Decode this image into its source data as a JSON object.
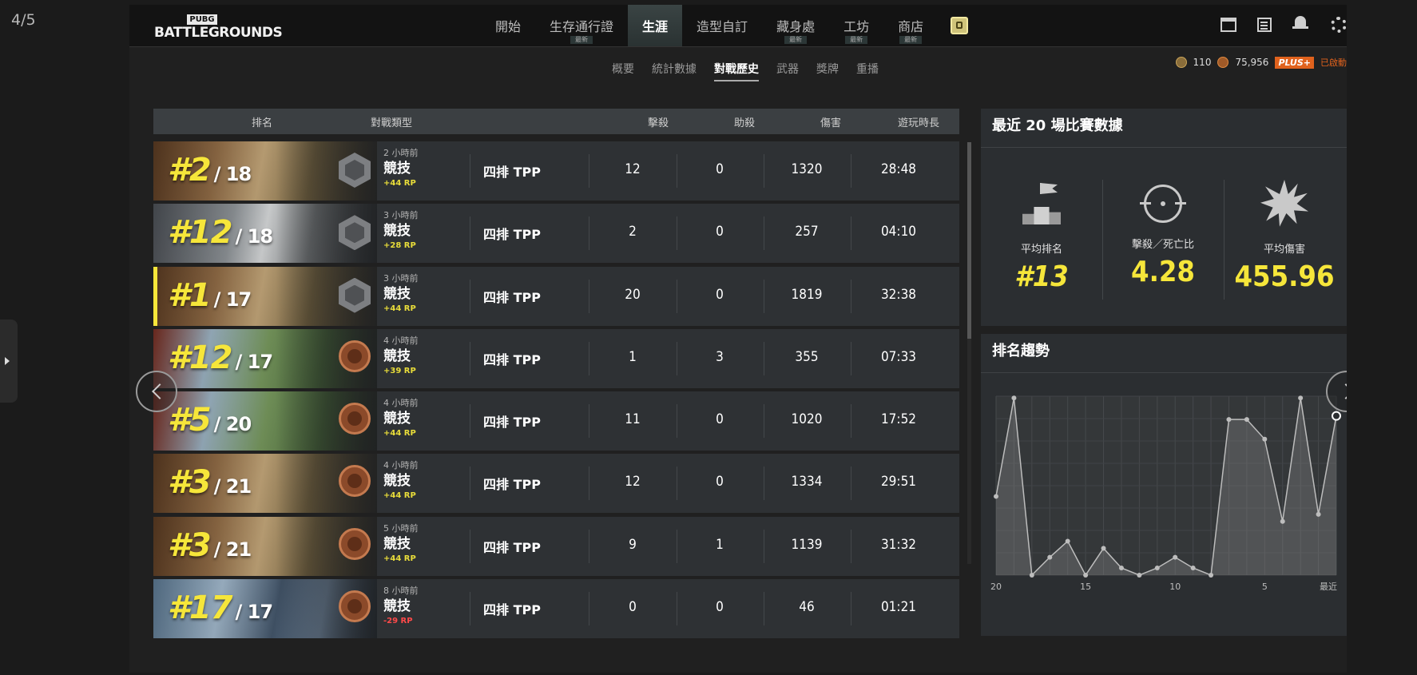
{
  "page_counter": "4/5",
  "header": {
    "logo_top": "PUBG",
    "logo_bottom": "BATTLEGROUNDS",
    "nav": [
      {
        "label": "開始",
        "badge": ""
      },
      {
        "label": "生存通行證",
        "badge": "最新"
      },
      {
        "label": "生涯",
        "badge": "",
        "active": true
      },
      {
        "label": "造型自訂",
        "badge": ""
      },
      {
        "label": "藏身處",
        "badge": "最新"
      },
      {
        "label": "工坊",
        "badge": "最新"
      },
      {
        "label": "商店",
        "badge": "最新"
      }
    ]
  },
  "subtabs": [
    "概要",
    "統計數據",
    "對戰歷史",
    "武器",
    "獎牌",
    "重播"
  ],
  "active_subtab": "對戰歷史",
  "currency": {
    "g_coin": "110",
    "bp": "75,956",
    "plus": "PLUS+",
    "owned": "已啟動"
  },
  "table": {
    "headers": {
      "rank": "排名",
      "type": "對戰類型",
      "kills": "擊殺",
      "assists": "助殺",
      "damage": "傷害",
      "time": "遊玩時長"
    },
    "rows": [
      {
        "rank": "#2",
        "total": "/ 18",
        "ago": "2 小時前",
        "mode": "競技",
        "rp": "+44 RP",
        "squad": "四排 TPP",
        "kills": "12",
        "assists": "0",
        "damage": "1320",
        "time": "28:48",
        "map": "warm",
        "tier": "silver",
        "highlight": false
      },
      {
        "rank": "#12",
        "total": "/ 18",
        "ago": "3 小時前",
        "mode": "競技",
        "rp": "+28 RP",
        "squad": "四排 TPP",
        "kills": "2",
        "assists": "0",
        "damage": "257",
        "time": "04:10",
        "map": "gray",
        "tier": "silver",
        "highlight": false
      },
      {
        "rank": "#1",
        "total": "/ 17",
        "ago": "3 小時前",
        "mode": "競技",
        "rp": "+44 RP",
        "squad": "四排 TPP",
        "kills": "20",
        "assists": "0",
        "damage": "1819",
        "time": "32:38",
        "map": "warm",
        "tier": "silver",
        "highlight": true
      },
      {
        "rank": "#12",
        "total": "/ 17",
        "ago": "4 小時前",
        "mode": "競技",
        "rp": "+39 RP",
        "squad": "四排 TPP",
        "kills": "1",
        "assists": "3",
        "damage": "355",
        "time": "07:33",
        "map": "green",
        "tier": "bronze",
        "highlight": false
      },
      {
        "rank": "#5",
        "total": "/ 20",
        "ago": "4 小時前",
        "mode": "競技",
        "rp": "+44 RP",
        "squad": "四排 TPP",
        "kills": "11",
        "assists": "0",
        "damage": "1020",
        "time": "17:52",
        "map": "green",
        "tier": "bronze",
        "highlight": false
      },
      {
        "rank": "#3",
        "total": "/ 21",
        "ago": "4 小時前",
        "mode": "競技",
        "rp": "+44 RP",
        "squad": "四排 TPP",
        "kills": "12",
        "assists": "0",
        "damage": "1334",
        "time": "29:51",
        "map": "warm",
        "tier": "bronze",
        "highlight": false
      },
      {
        "rank": "#3",
        "total": "/ 21",
        "ago": "5 小時前",
        "mode": "競技",
        "rp": "+44 RP",
        "squad": "四排 TPP",
        "kills": "9",
        "assists": "1",
        "damage": "1139",
        "time": "31:32",
        "map": "warm",
        "tier": "bronze",
        "highlight": false
      },
      {
        "rank": "#17",
        "total": "/ 17",
        "ago": "8 小時前",
        "mode": "競技",
        "rp": "-29 RP",
        "squad": "四排 TPP",
        "kills": "0",
        "assists": "0",
        "damage": "46",
        "time": "01:21",
        "map": "snow",
        "tier": "bronze",
        "highlight": false
      }
    ]
  },
  "stats_panel": {
    "title": "最近 20 場比賽數據",
    "items": [
      {
        "icon": "podium-icon",
        "label": "平均排名",
        "value": "#13"
      },
      {
        "icon": "crosshair-icon",
        "label": "擊殺／死亡比",
        "value": "4.28"
      },
      {
        "icon": "damage-burst-icon",
        "label": "平均傷害",
        "value": "455.96"
      }
    ]
  },
  "trend_panel": {
    "title": "排名趨勢"
  },
  "chart_data": {
    "type": "area",
    "x_tick_labels": [
      "20",
      "15",
      "10",
      "5",
      "最近"
    ],
    "x": [
      20,
      19,
      18,
      17,
      16,
      15,
      14,
      13,
      12,
      11,
      10,
      9,
      8,
      7,
      6,
      5,
      4,
      3,
      2,
      1
    ],
    "y_rank_normalized": [
      0.44,
      0.99,
      0.0,
      0.1,
      0.19,
      0.0,
      0.15,
      0.04,
      0.0,
      0.04,
      0.1,
      0.04,
      0.0,
      0.87,
      0.87,
      0.76,
      0.3,
      0.99,
      0.34,
      0.89
    ],
    "series_color": "#bdbdbd",
    "fill_color": "#8a8a8a",
    "last_point_highlight": true
  },
  "colors": {
    "accent_yellow": "#f6e63a",
    "rp_positive": "#e9dd3a",
    "rp_negative": "#ff4a4a",
    "plus_orange": "#e0621d"
  }
}
